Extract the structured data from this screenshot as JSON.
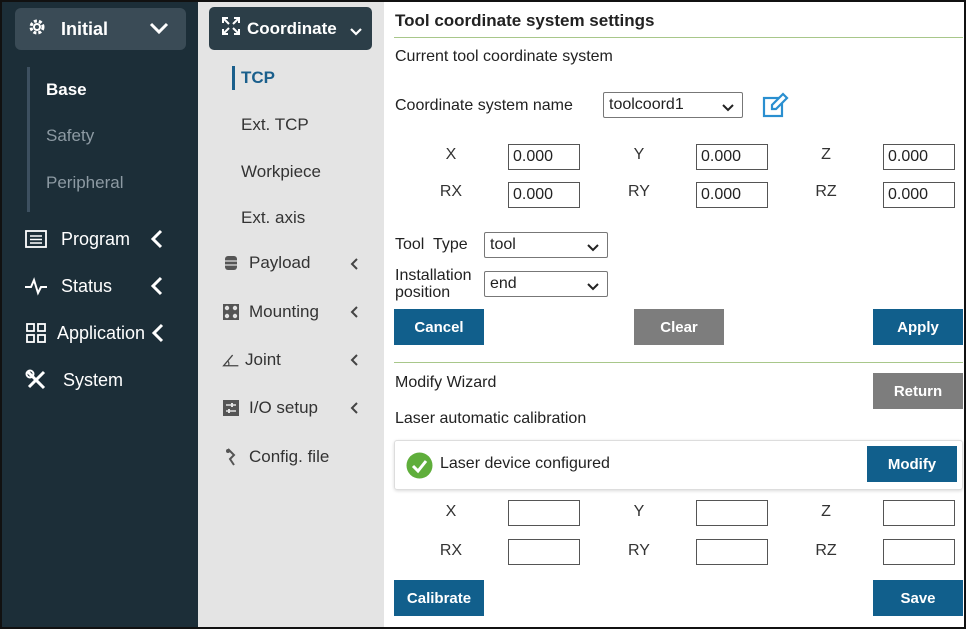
{
  "leftnav": {
    "initial_label": "Initial",
    "sub_items": [
      "Base",
      "Safety",
      "Peripheral"
    ],
    "items": [
      {
        "label": "Program",
        "icon": "list-icon"
      },
      {
        "label": "Status",
        "icon": "pulse-icon"
      },
      {
        "label": "Application",
        "icon": "grid-icon"
      },
      {
        "label": "System",
        "icon": "tools-icon"
      }
    ]
  },
  "midnav": {
    "coordinate_label": "Coordinate",
    "sub_items": [
      "TCP",
      "Ext. TCP",
      "Workpiece",
      "Ext. axis"
    ],
    "items": [
      {
        "label": "Payload",
        "icon": "payload-icon"
      },
      {
        "label": "Mounting",
        "icon": "mounting-icon"
      },
      {
        "label": "Joint",
        "icon": "joint-icon"
      },
      {
        "label": "I/O setup",
        "icon": "io-icon"
      },
      {
        "label": "Config. file",
        "icon": "config-icon"
      }
    ]
  },
  "content": {
    "title": "Tool coordinate system settings",
    "current_label": "Current tool coordinate system",
    "name_label": "Coordinate system name",
    "name_value": "toolcoord1",
    "axes": {
      "x": "X",
      "y": "Y",
      "z": "Z",
      "rx": "RX",
      "ry": "RY",
      "rz": "RZ"
    },
    "values": {
      "x": "0.000",
      "y": "0.000",
      "z": "0.000",
      "rx": "0.000",
      "ry": "0.000",
      "rz": "0.000"
    },
    "tool_type_label": "Tool  Type",
    "tool_type_value": "tool",
    "install_label_1": "Installation",
    "install_label_2": "position",
    "install_value": "end",
    "cancel": "Cancel",
    "clear": "Clear",
    "apply": "Apply",
    "wizard_label": "Modify Wizard",
    "return": "Return",
    "laser_label": "Laser automatic calibration",
    "laser_status": "Laser device configured",
    "modify": "Modify",
    "calibrate": "Calibrate",
    "save": "Save"
  },
  "colors": {
    "nav_dark": "#1c2e38",
    "accent_blue": "#115f8c",
    "gray_button": "#7d7d7d",
    "divider_green": "#a8c78a",
    "ok_green": "#5fae3b"
  }
}
